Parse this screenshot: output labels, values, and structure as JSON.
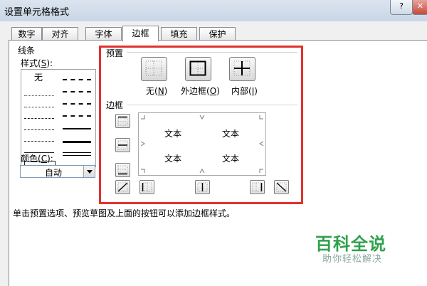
{
  "window": {
    "title": "设置单元格格式",
    "help_label": "?",
    "close_label": "✕"
  },
  "tabs": [
    {
      "label": "数字"
    },
    {
      "label": "对齐"
    },
    {
      "label": "字体"
    },
    {
      "label": "边框",
      "active": true
    },
    {
      "label": "填充"
    },
    {
      "label": "保护"
    }
  ],
  "line": {
    "group_label": "线条",
    "style_label_prefix": "样式(",
    "style_key": "S",
    "style_label_suffix": "):",
    "none_label": "无",
    "color_label_prefix": "颜色(",
    "color_key": "C",
    "color_label_suffix": "):",
    "color_value": "自动"
  },
  "preset": {
    "group_label": "预置",
    "buttons": [
      {
        "label_prefix": "无(",
        "key": "N",
        "label_suffix": ")",
        "icon": "border-none-icon"
      },
      {
        "label_prefix": "外边框(",
        "key": "O",
        "label_suffix": ")",
        "icon": "border-outline-icon"
      },
      {
        "label_prefix": "内部(",
        "key": "I",
        "label_suffix": ")",
        "icon": "border-inside-icon"
      }
    ]
  },
  "border": {
    "group_label": "边框",
    "cell_text": [
      "文本",
      "文本",
      "文本",
      "文本"
    ]
  },
  "description": "单击预置选项、预览草图及上面的按钮可以添加边框样式。",
  "watermark": {
    "main": "百科全说",
    "sub": "助你轻松解决"
  },
  "colors": {
    "highlight_border": "#e2312e",
    "watermark_green": "#2fa14b"
  }
}
